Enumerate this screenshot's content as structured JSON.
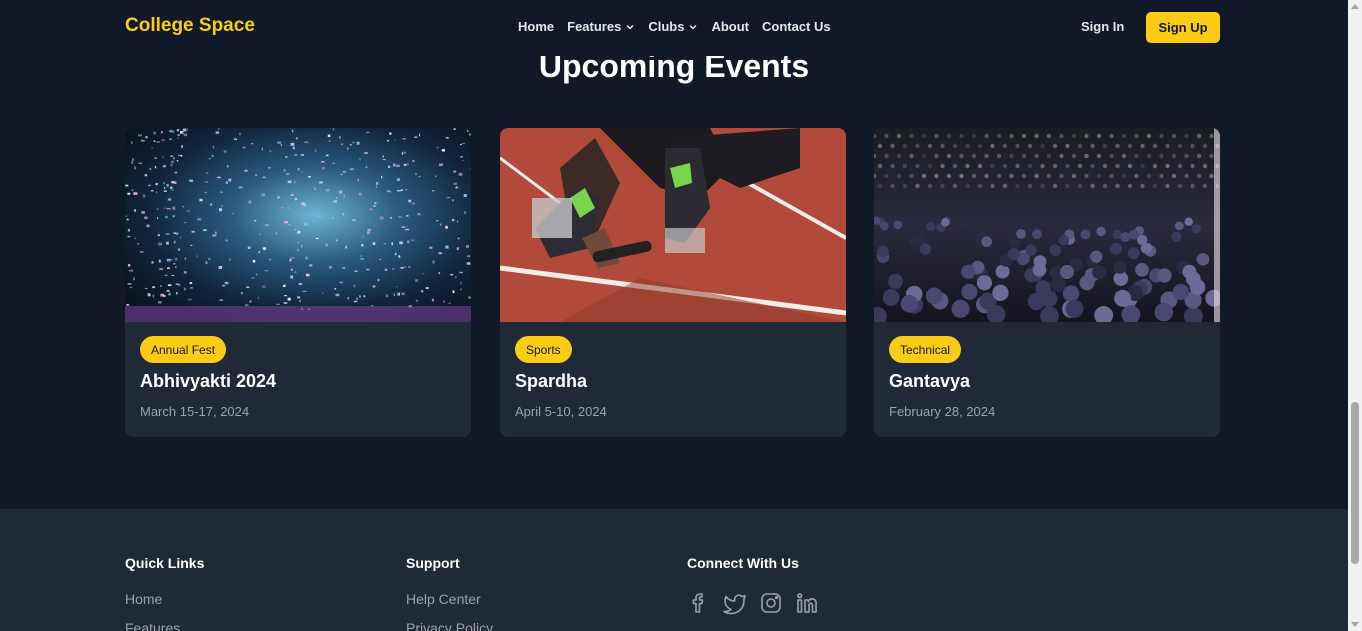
{
  "nav": {
    "brand": "College Space",
    "links": [
      {
        "label": "Home",
        "dropdown": false
      },
      {
        "label": "Features",
        "dropdown": true
      },
      {
        "label": "Clubs",
        "dropdown": true
      },
      {
        "label": "About",
        "dropdown": false
      },
      {
        "label": "Contact Us",
        "dropdown": false
      }
    ],
    "sign_in": "Sign In",
    "sign_up": "Sign Up"
  },
  "events": {
    "title": "Upcoming Events",
    "cards": [
      {
        "badge": "Annual Fest",
        "title": "Abhivyakti 2024",
        "date": "March 15-17, 2024",
        "image": "confetti-concert-photo"
      },
      {
        "badge": "Sports",
        "title": "Spardha",
        "date": "April 5-10, 2024",
        "image": "relay-sprinter-photo"
      },
      {
        "badge": "Technical",
        "title": "Gantavya",
        "date": "February 28, 2024",
        "image": "seminar-audience-photo"
      }
    ]
  },
  "footer": {
    "quick_links": {
      "heading": "Quick Links",
      "items": [
        "Home",
        "Features"
      ]
    },
    "support": {
      "heading": "Support",
      "items": [
        "Help Center",
        "Privacy Policy"
      ]
    },
    "connect": {
      "heading": "Connect With Us",
      "icons": [
        "facebook-icon",
        "twitter-icon",
        "instagram-icon",
        "linkedin-icon"
      ]
    }
  },
  "colors": {
    "background": "#111827",
    "card": "#1f2937",
    "accent": "#facc15",
    "muted_text": "#9ca3af"
  }
}
